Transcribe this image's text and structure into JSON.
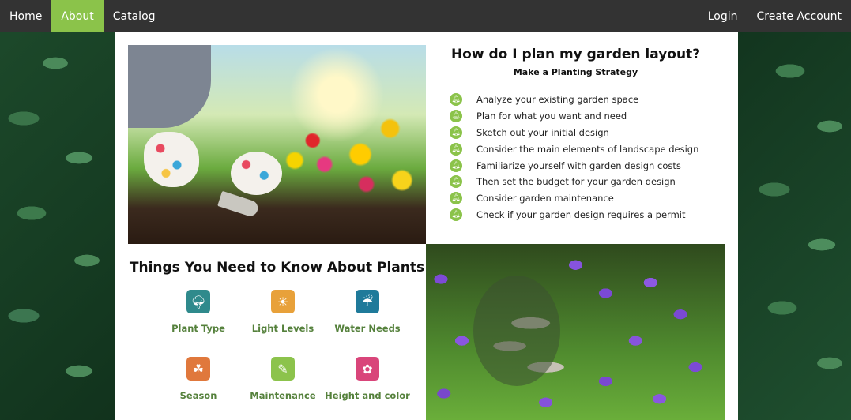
{
  "nav": {
    "home": "Home",
    "about": "About",
    "catalog": "Catalog",
    "login": "Login",
    "create_account": "Create Account"
  },
  "faq": {
    "title": "How do I plan my garden layout?",
    "subtitle": "Make a Planting Strategy",
    "items": [
      "Analyze your existing garden space",
      "Plan for what you want and need",
      "Sketch out your initial design",
      "Consider the main elements of landscape design",
      "Familiarize yourself with garden design costs",
      "Then set the budget for your garden design",
      "Consider garden maintenance",
      "Check if your garden design requires a permit"
    ],
    "bullet_icon": "bell-icon"
  },
  "plants": {
    "title": "Things You Need to Know About Plants",
    "items": [
      {
        "label": "Plant Type",
        "icon": "tree-icon",
        "color": "#2f8a8c"
      },
      {
        "label": "Light Levels",
        "icon": "sun-icon",
        "color": "#e8a13a"
      },
      {
        "label": "Water Needs",
        "icon": "watering-can-icon",
        "color": "#1f7a9a"
      },
      {
        "label": "Season",
        "icon": "leaf-icon",
        "color": "#e0783c"
      },
      {
        "label": "Maintenance",
        "icon": "trowel-icon",
        "color": "#8cc34c"
      },
      {
        "label": "Height and color",
        "icon": "flower-icon",
        "color": "#d9457a"
      }
    ]
  },
  "colors": {
    "nav_bg": "#333333",
    "nav_active": "#8bc34a",
    "accent": "#8bc34a",
    "label_green": "#55813c"
  }
}
